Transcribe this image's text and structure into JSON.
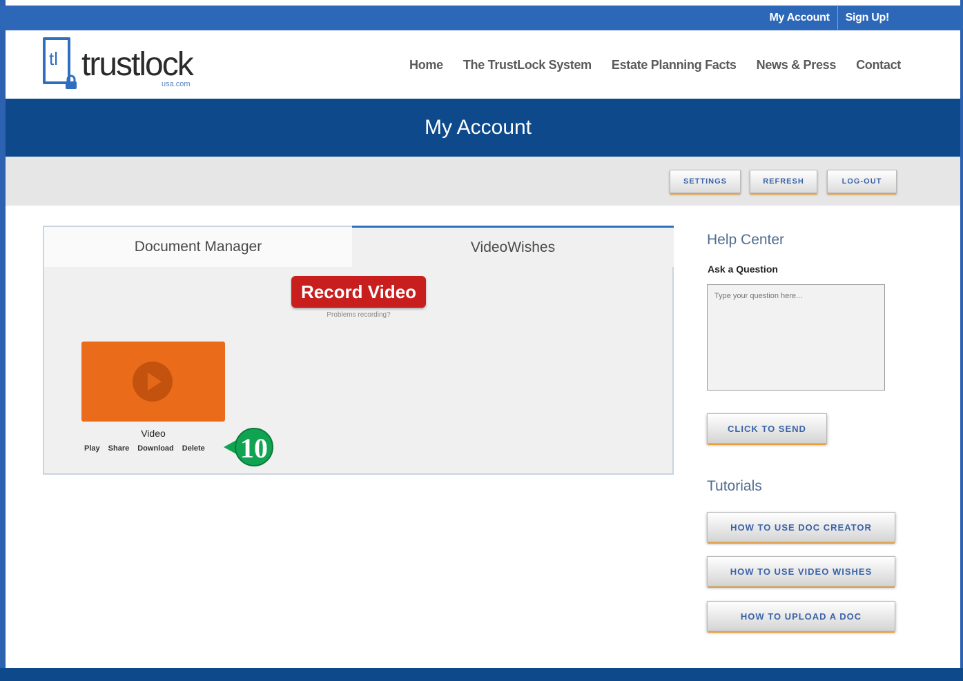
{
  "topbar": {
    "my_account": "My Account",
    "sign_up": "Sign Up!"
  },
  "logo": {
    "mark": "tl",
    "word_a": "trust",
    "word_b": "lock",
    "sub": "usa.com"
  },
  "nav": [
    "Home",
    "The TrustLock System",
    "Estate Planning Facts",
    "News & Press",
    "Contact"
  ],
  "hero": {
    "title": "My Account"
  },
  "toolbar": {
    "settings": "SETTINGS",
    "refresh": "REFRESH",
    "logout": "LOG-OUT"
  },
  "tabs": {
    "doc_manager": "Document Manager",
    "video_wishes": "VideoWishes"
  },
  "record": {
    "label": "Record Video",
    "problems": "Problems recording?"
  },
  "video": {
    "title": "Video",
    "actions": {
      "play": "Play",
      "share": "Share",
      "download": "Download",
      "delete": "Delete"
    }
  },
  "callout": {
    "number": "10",
    "color": "#10a452"
  },
  "help": {
    "title": "Help Center",
    "ask_label": "Ask a Question",
    "placeholder": "Type your question here...",
    "send": "CLICK TO SEND"
  },
  "tutorials": {
    "title": "Tutorials",
    "doc_creator": "HOW TO USE DOC CREATOR",
    "video_wishes": "HOW TO USE VIDEO WISHES",
    "upload_doc": "HOW TO UPLOAD A DOC"
  },
  "colors": {
    "topbar": "#2d68b8",
    "hero": "#0e4a8b",
    "record": "#c81e1e",
    "thumb": "#ea6c1a",
    "button_text": "#3a63a8",
    "button_accent": "#e9a23b"
  }
}
